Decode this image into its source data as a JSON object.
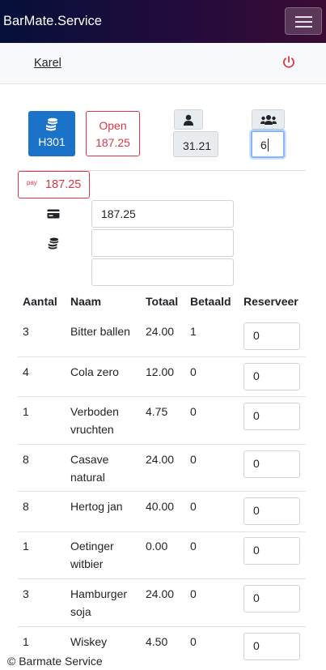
{
  "app": {
    "brand": "BarMate.Service"
  },
  "user": {
    "name": "Karel"
  },
  "table_button": {
    "label": "H301"
  },
  "open_button": {
    "line1": "Open",
    "line2": "187.25"
  },
  "person_value": "31.21",
  "guests_value": "6",
  "pay_button": {
    "icon_text": "pay",
    "amount": "187.25"
  },
  "payment": {
    "card_value": "187.25",
    "cash_value": "",
    "extra_value": ""
  },
  "table": {
    "headers": [
      "Aantal",
      "Naam",
      "Totaal",
      "Betaald",
      "Reserveer"
    ],
    "rows": [
      {
        "aantal": "3",
        "naam1": "Bitter ballen",
        "naam2": "",
        "totaal": "24.00",
        "betaald": "1",
        "reserveer": "0"
      },
      {
        "aantal": "4",
        "naam1": "Cola zero",
        "naam2": "",
        "totaal": "12.00",
        "betaald": "0",
        "reserveer": "0"
      },
      {
        "aantal": "1",
        "naam1": "Verboden",
        "naam2": "vruchten",
        "totaal": "4.75",
        "betaald": "0",
        "reserveer": "0"
      },
      {
        "aantal": "8",
        "naam1": "Casave",
        "naam2": "natural",
        "totaal": "24.00",
        "betaald": "0",
        "reserveer": "0"
      },
      {
        "aantal": "8",
        "naam1": "Hertog jan",
        "naam2": "",
        "totaal": "40.00",
        "betaald": "0",
        "reserveer": "0"
      },
      {
        "aantal": "1",
        "naam1": "Oetinger",
        "naam2": "witbier",
        "totaal": "0.00",
        "betaald": "0",
        "reserveer": "0"
      },
      {
        "aantal": "3",
        "naam1": "Hamburger",
        "naam2": "soja",
        "totaal": "24.00",
        "betaald": "0",
        "reserveer": "0"
      },
      {
        "aantal": "1",
        "naam1": "Wiskey",
        "naam2": "",
        "totaal": "4.50",
        "betaald": "0",
        "reserveer": "0"
      }
    ]
  },
  "footer": {
    "text": "© Barmate Service"
  },
  "colors": {
    "primary": "#1a73c8",
    "danger": "#dc3545",
    "nav_start": "#06103a",
    "nav_end": "#3a0c34"
  }
}
